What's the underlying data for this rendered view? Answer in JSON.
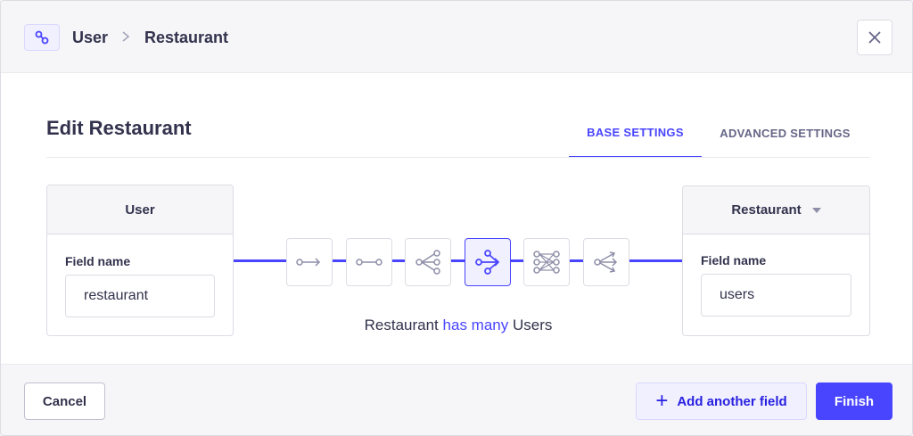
{
  "header": {
    "icon": "relation-icon",
    "breadcrumb": [
      "User",
      "Restaurant"
    ]
  },
  "title": "Edit Restaurant",
  "tabs": [
    {
      "label": "BASE SETTINGS",
      "active": true
    },
    {
      "label": "ADVANCED SETTINGS",
      "active": false
    }
  ],
  "left_box": {
    "title": "User",
    "field_label": "Field name",
    "field_value": "restaurant"
  },
  "right_box": {
    "title": "Restaurant",
    "field_label": "Field name",
    "field_value": "users"
  },
  "relations": [
    {
      "name": "one-way-icon",
      "active": false
    },
    {
      "name": "one-to-one-icon",
      "active": false
    },
    {
      "name": "one-to-many-icon",
      "active": false
    },
    {
      "name": "many-to-one-icon",
      "active": true
    },
    {
      "name": "many-to-many-icon",
      "active": false
    },
    {
      "name": "many-way-icon",
      "active": false
    }
  ],
  "sentence": {
    "left": "Restaurant",
    "relation": "has many",
    "right": "Users"
  },
  "footer": {
    "cancel_label": "Cancel",
    "add_label": "Add another field",
    "finish_label": "Finish"
  },
  "colors": {
    "accent": "#4945ff",
    "neutral": "#8e8ea9"
  }
}
